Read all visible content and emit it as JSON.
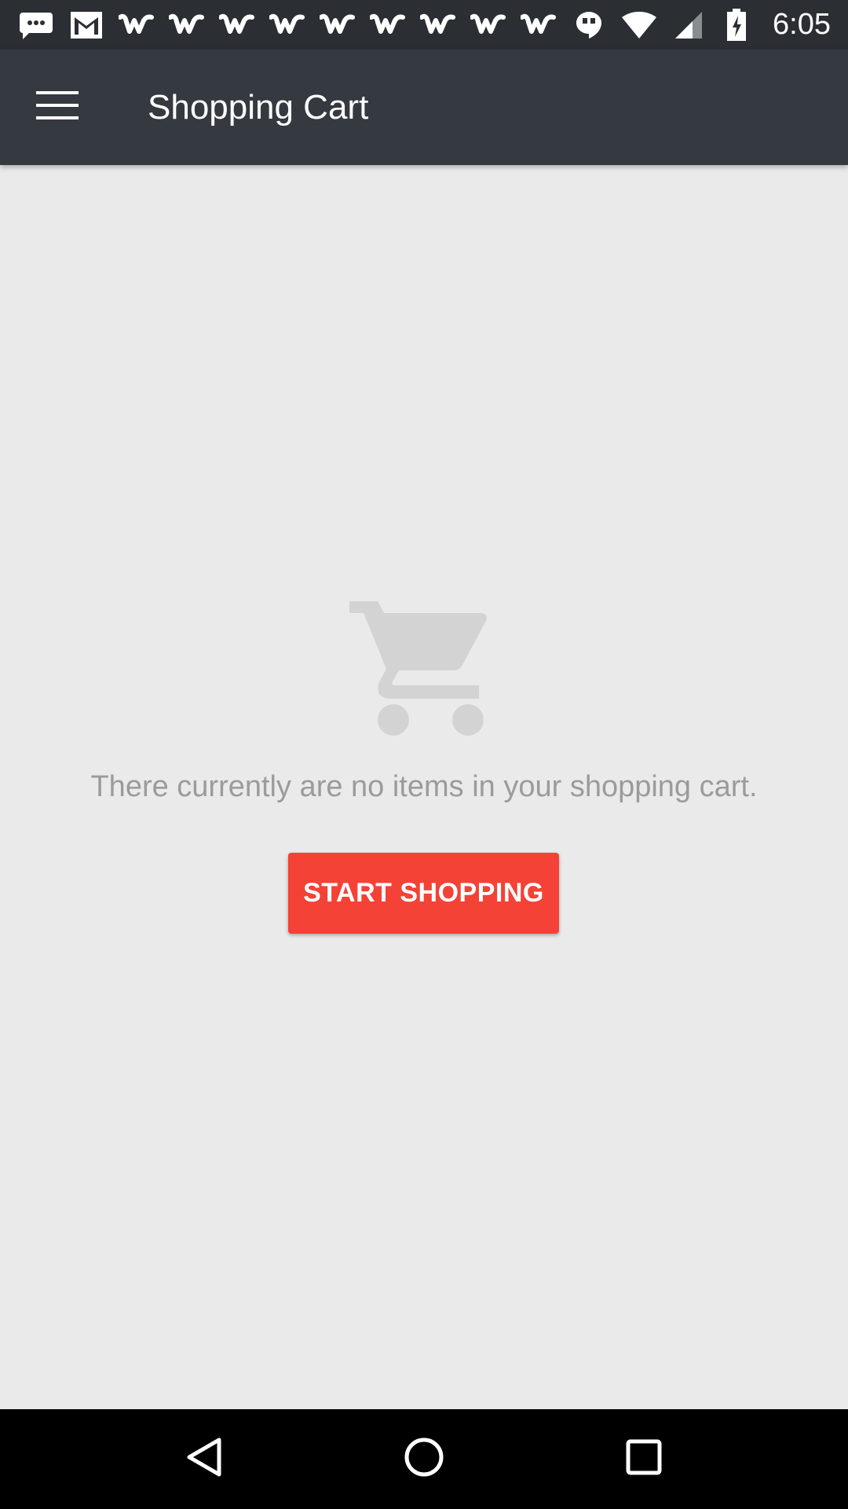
{
  "status_bar": {
    "time": "6:05",
    "left_icons": [
      "chat-icon",
      "gmail-icon",
      "w-app-icon",
      "w-app-icon",
      "w-app-icon",
      "w-app-icon",
      "w-app-icon",
      "w-app-icon",
      "w-app-icon",
      "w-app-icon",
      "w-app-icon",
      "hangouts-icon"
    ],
    "right_icons": [
      "wifi-icon",
      "signal-icon",
      "battery-charging-icon"
    ]
  },
  "app_bar": {
    "title": "Shopping Cart",
    "menu_icon": "hamburger-menu-icon",
    "background": "#353a41"
  },
  "empty_state": {
    "icon": "shopping-cart-icon",
    "message": "There currently are no items in your shopping cart.",
    "button_label": "START SHOPPING",
    "button_color": "#f44236"
  },
  "nav_bar": {
    "icons": [
      "back-icon",
      "home-icon",
      "recents-icon"
    ]
  }
}
